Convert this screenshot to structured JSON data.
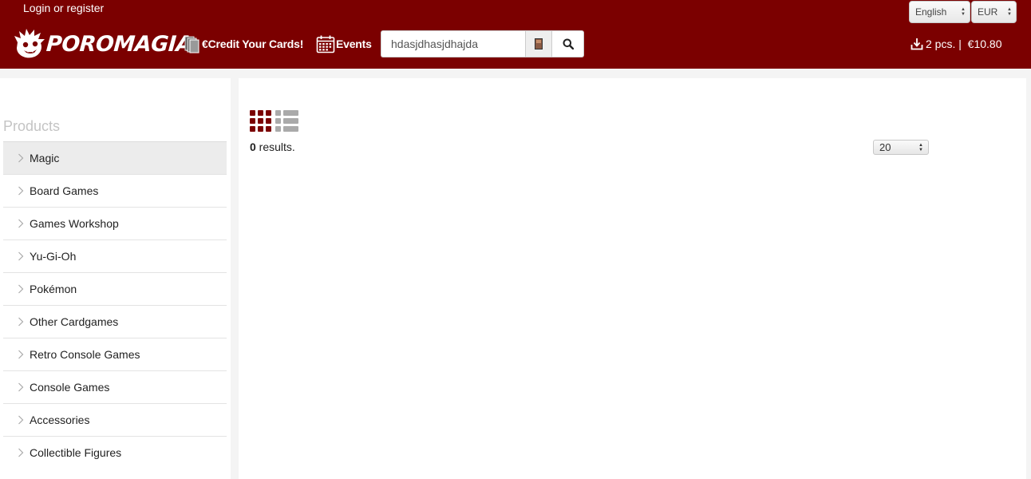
{
  "header": {
    "login_label": "Login or register",
    "logo_text": "POROMAGIA",
    "credit_label": "€Credit Your Cards!",
    "events_label": "Events",
    "search_value": "hdasjdhasjdhajda",
    "language": "English",
    "currency": "EUR",
    "cart_label": "2 pcs. |  €10.80"
  },
  "sidebar": {
    "heading": "Products",
    "items": [
      {
        "label": "Magic"
      },
      {
        "label": "Board Games"
      },
      {
        "label": "Games Workshop"
      },
      {
        "label": "Yu-Gi-Oh"
      },
      {
        "label": "Pokémon"
      },
      {
        "label": "Other Cardgames"
      },
      {
        "label": "Retro Console Games"
      },
      {
        "label": "Console Games"
      },
      {
        "label": "Accessories"
      },
      {
        "label": "Collectible Figures"
      }
    ]
  },
  "main": {
    "result_count": "0",
    "result_suffix": " results.",
    "per_page": "20"
  },
  "colors": {
    "brand": "#7b0000",
    "active_view": "#7b0000",
    "inactive_view": "#aaaaaa"
  }
}
